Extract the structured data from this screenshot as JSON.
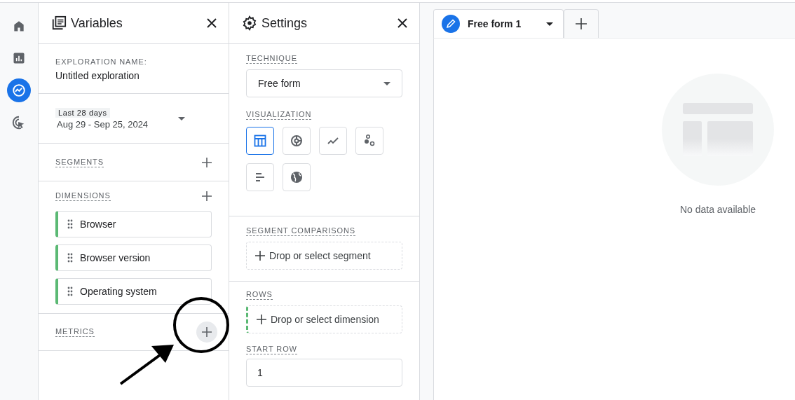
{
  "nav_rail": {
    "items": [
      {
        "kind": "home",
        "selected": false
      },
      {
        "kind": "reports",
        "selected": false
      },
      {
        "kind": "explore",
        "selected": true
      },
      {
        "kind": "advertising",
        "selected": false
      }
    ]
  },
  "variables": {
    "title": "Variables",
    "exploration_name_label": "EXPLORATION NAME:",
    "exploration_name": "Untitled exploration",
    "date_range": {
      "badge": "Last 28 days",
      "range": "Aug 29 - Sep 25, 2024"
    },
    "segments": {
      "label": "SEGMENTS"
    },
    "dimensions": {
      "label": "DIMENSIONS",
      "items": [
        {
          "label": "Browser"
        },
        {
          "label": "Browser version"
        },
        {
          "label": "Operating system"
        }
      ]
    },
    "metrics": {
      "label": "METRICS"
    }
  },
  "settings": {
    "title": "Settings",
    "technique": {
      "label": "TECHNIQUE",
      "value": "Free form"
    },
    "visualization": {
      "label": "VISUALIZATION",
      "options": [
        {
          "kind": "table",
          "selected": true
        },
        {
          "kind": "donut",
          "selected": false
        },
        {
          "kind": "line",
          "selected": false
        },
        {
          "kind": "scatter",
          "selected": false
        },
        {
          "kind": "bar",
          "selected": false
        },
        {
          "kind": "geo",
          "selected": false
        }
      ]
    },
    "segment_comparisons": {
      "label": "SEGMENT COMPARISONS",
      "placeholder": "Drop or select segment"
    },
    "rows": {
      "label": "ROWS",
      "placeholder": "Drop or select dimension"
    },
    "start_row": {
      "label": "START ROW",
      "value": "1"
    }
  },
  "tabs": [
    {
      "label": "Free form 1",
      "selected": true
    }
  ],
  "empty_state": {
    "text": "No data available"
  }
}
